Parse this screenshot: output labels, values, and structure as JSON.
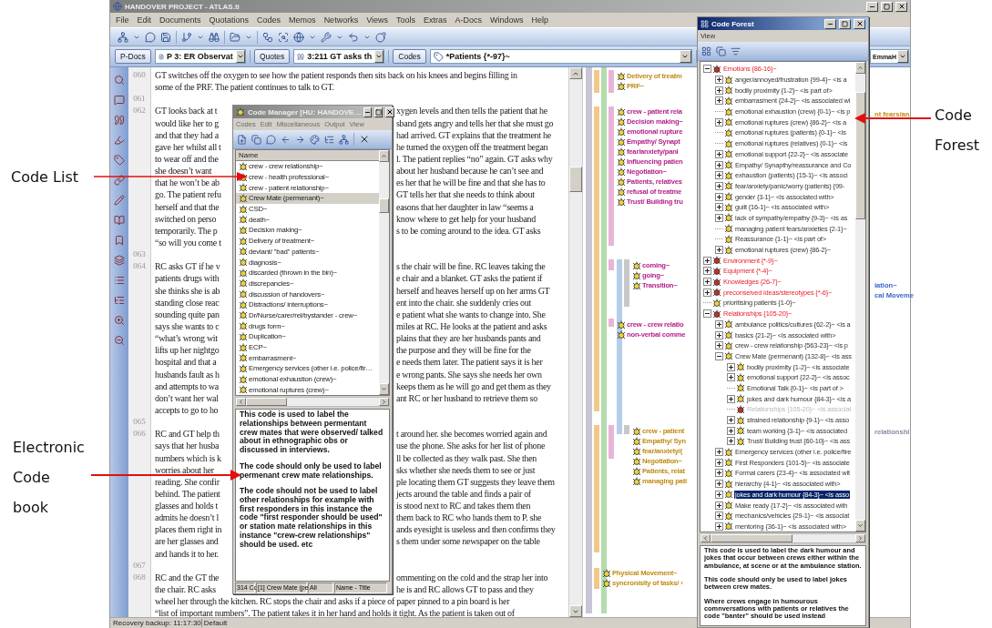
{
  "annotations": [
    {
      "text": "Code List"
    },
    {
      "text": "Electronic Code book"
    },
    {
      "text": "Code Forest"
    }
  ],
  "window": {
    "title": "HANDOVER PROJECT - ATLAS.ti",
    "active": false,
    "menu": [
      "File",
      "Edit",
      "Documents",
      "Quotations",
      "Codes",
      "Memos",
      "Networks",
      "Views",
      "Tools",
      "Extras",
      "A-Docs",
      "Windows",
      "Help"
    ],
    "status": "Recovery backup: 11:17:30",
    "status_right": "Default"
  },
  "selectors": [
    {
      "kind": "document",
      "button": "P-Docs",
      "value": "P 3: ER Observat"
    },
    {
      "kind": "quotation",
      "button": "Quotes",
      "value": "3:211 GT asks th"
    },
    {
      "kind": "code",
      "button": "Codes",
      "value": "*Patients {*-97}~"
    }
  ],
  "user_combo": "EmmaH",
  "document": [
    {
      "kind": "full",
      "number": "060",
      "text": "GT switches off the oxygen to see how the patient responds then sits back on his knees and begins filling in"
    },
    {
      "kind": "full",
      "text": "some of the PRF. The patient continues to talk to GT."
    },
    {
      "kind": "blank",
      "number": "061"
    },
    {
      "kind": "split",
      "number": "062",
      "left": "GT looks back at t",
      "right": "xygen levels and then tells the patient that he"
    },
    {
      "kind": "split",
      "left": "would like her to g",
      "right": "sband gets angry and tells her that she must go"
    },
    {
      "kind": "split",
      "left": "and that they had a",
      "right": "had arrived. GT explains that the treatment he"
    },
    {
      "kind": "split",
      "left": "gave her whilst all t",
      "right": "he turned the oxygen off the treatment began"
    },
    {
      "kind": "split",
      "left": "to wear off and the",
      "right": "l. The patient replies “no” again. GT asks why"
    },
    {
      "kind": "split",
      "left": "she doesn’t want",
      "right": "about her husband because he can’t see and"
    },
    {
      "kind": "split",
      "left": "that he won’t be ab",
      "right": "es her that he will be fine and that she has to"
    },
    {
      "kind": "split",
      "left": "go. The patient refu",
      "right": "GT tells her that she needs to think about"
    },
    {
      "kind": "split",
      "left": "herself and that the",
      "right": "easons that her daughter in law “seems a"
    },
    {
      "kind": "split",
      "left": "switched on perso",
      "right": "know where to get help for your husband"
    },
    {
      "kind": "split",
      "left": "temporarily. The p",
      "right": "s to be coming around to the idea. GT asks"
    },
    {
      "kind": "split",
      "left": "“so will you come t"
    },
    {
      "kind": "blank",
      "number": "063"
    },
    {
      "kind": "split",
      "number": "064",
      "left": "RC asks GT if he v",
      "right": "s the chair will be fine. RC leaves taking the"
    },
    {
      "kind": "split",
      "left": "patients drugs with",
      "right": "e chair and a blanket. GT asks the patient if"
    },
    {
      "kind": "split",
      "left": "she thinks she is ab",
      "right": "herself and heaves herself up on her arms GT"
    },
    {
      "kind": "split",
      "left": "standing close reac",
      "right": "ent into the chair. she suddenly cries out"
    },
    {
      "kind": "split",
      "left": "sounding quite pan",
      "right": "e patient what she wants to change into. She"
    },
    {
      "kind": "split",
      "left": "says she wants to c",
      "right": "miles at RC. He looks at the patient and asks"
    },
    {
      "kind": "split",
      "left": "“what’s wrong wit",
      "right": "plains that they are her husbands pants and"
    },
    {
      "kind": "split",
      "left": "lifts up her nightgo",
      "right": "the purpose and they will be fine for the"
    },
    {
      "kind": "split",
      "left": "hospital and that a",
      "right": "e needs them later. The patient says it is her"
    },
    {
      "kind": "split",
      "left": "husbands fault as h",
      "right": "e wrong pants. She says she needs her own"
    },
    {
      "kind": "split",
      "left": "and attempts to wa",
      "right": "keeps them as he will go and get them as they"
    },
    {
      "kind": "split",
      "left": "don’t want her wal",
      "right": "ant RC or her husband to retrieve them so"
    },
    {
      "kind": "split",
      "left": "accepts to go to ho"
    },
    {
      "kind": "blank",
      "number": "065"
    },
    {
      "kind": "split",
      "number": "066",
      "left": "RC and GT help th",
      "right": "t around her. she becomes worried again and"
    },
    {
      "kind": "split",
      "left": "says that her husba",
      "right": "use the phone. She asks for her list of phone"
    },
    {
      "kind": "split",
      "left": "numbers which is k",
      "right": "ll be collected as they walk past. She then"
    },
    {
      "kind": "split",
      "left": "worries about her",
      "right": "sks whether she needs them to see or just"
    },
    {
      "kind": "split",
      "left": "reading. She confir",
      "right": "ple locating them GT suggests they leave them"
    },
    {
      "kind": "split",
      "left": "behind. The patient",
      "right": "jects around the table and finds a pair of"
    },
    {
      "kind": "split",
      "left": "glasses and holds t",
      "right": "is stood next to RC and takes them then"
    },
    {
      "kind": "split",
      "left": "admits he doesn’t l",
      "right": "them back to RC who hands them to P. she"
    },
    {
      "kind": "split",
      "left": "places them right in",
      "right": "ands eyesight is useless and then confirms they"
    },
    {
      "kind": "split",
      "left": "are her glasses and",
      "right": "s them under some newspaper on the table"
    },
    {
      "kind": "split",
      "left": "and hands it to her."
    },
    {
      "kind": "blank",
      "number": "067"
    },
    {
      "kind": "split",
      "number": "068",
      "left": "RC and the GT the",
      "right": "ommenting on the cold and the strap her into"
    },
    {
      "kind": "split",
      "left": "the chair. RC asks",
      "right": "he is and RC allows GT to pass and they"
    },
    {
      "kind": "full",
      "text": "wheel her through the kitchen. RC stops the chair and asks if a piece of paper pinned to a pin board is her"
    },
    {
      "kind": "full",
      "text": "“list of important numbers”. The patient takes it in her hand and holds it tight. As the patient is taken out of"
    }
  ],
  "margin_groups": [
    [
      {
        "label": "Delivery of treatm",
        "color": "#c08a10"
      },
      {
        "label": "PRF~",
        "color": "#c08a10"
      }
    ],
    [
      {
        "label": "crew - patient rela",
        "color": "#b4208c"
      },
      {
        "label": "Decision making~",
        "color": "#b4208c"
      },
      {
        "label": "emotional rupture",
        "color": "#b4208c"
      },
      {
        "label": "Empathy/ Synapt",
        "color": "#b4208c"
      },
      {
        "label": "fear/anxiety/pani",
        "color": "#b4208c"
      },
      {
        "label": "Influencing patien",
        "color": "#b4208c"
      },
      {
        "label": "Negotiation~",
        "color": "#b4208c"
      },
      {
        "label": "Patients, relatives",
        "color": "#b4208c"
      },
      {
        "label": "refusal of treatme",
        "color": "#b4208c"
      },
      {
        "label": "Trust/ Building tru",
        "color": "#b4208c"
      }
    ],
    [
      {
        "label": "coming~",
        "color": "#b4208c"
      },
      {
        "label": "going~",
        "color": "#b4208c"
      },
      {
        "label": "Transition~",
        "color": "#b4208c"
      }
    ],
    [
      {
        "label": "crew - crew relatio",
        "color": "#b4208c"
      },
      {
        "label": "non-verbal comme",
        "color": "#b4208c"
      }
    ],
    [
      {
        "label": "crew - patient",
        "color": "#c08a10"
      },
      {
        "label": "Empathy/ Syn",
        "color": "#c08a10"
      },
      {
        "label": "fear/anxiety/(",
        "color": "#c08a10"
      },
      {
        "label": "Negotiation~",
        "color": "#c08a10"
      },
      {
        "label": "Patients, relat",
        "color": "#c08a10"
      },
      {
        "label": "managing pati",
        "color": "#c08a10"
      }
    ],
    [
      {
        "label": "Physical Movement~",
        "color": "#c08a10"
      },
      {
        "label": "syncronisity of tasks/ ‹",
        "color": "#c08a10"
      }
    ]
  ],
  "right_strip": [
    {
      "text": "nt fears/an",
      "color": "#c08a10"
    },
    {
      "text": "iation~",
      "color": "#3a66c8"
    },
    {
      "text": "cal Moveme",
      "color": "#3a66c8"
    },
    {
      "text": "relationshi",
      "color": "#8a8aa0"
    }
  ],
  "code_manager": {
    "title": "Code Manager [HU: HANDOVE…",
    "active": false,
    "menu": [
      "Codes",
      "Edit",
      "Miscellaneous",
      "Output",
      "View"
    ],
    "column": "Name",
    "items": [
      {
        "label": "crew - crew relationship~",
        "selected": false
      },
      {
        "label": "crew - health professional~",
        "selected": false
      },
      {
        "label": "crew - patient relationship~",
        "selected": false
      },
      {
        "label": "Crew Mate (permenant)~",
        "selected": true
      },
      {
        "label": "CSD~",
        "selected": false
      },
      {
        "label": "death~",
        "selected": false
      },
      {
        "label": "Decision making~",
        "selected": false
      },
      {
        "label": "Delivery of treatment~",
        "selected": false
      },
      {
        "label": "deviant/ \"bad\" patients~",
        "selected": false
      },
      {
        "label": "diagnosis~",
        "selected": false
      },
      {
        "label": "discarded (thrown in the bin)~",
        "selected": false
      },
      {
        "label": "discrepancies~",
        "selected": false
      },
      {
        "label": "discussion of handovers~",
        "selected": false
      },
      {
        "label": "Distractions/ interruptions~",
        "selected": false
      },
      {
        "label": "Dr/Nurse/carer/rel/bystander - crew~",
        "selected": false
      },
      {
        "label": "drugs form~",
        "selected": false
      },
      {
        "label": "Duplication~",
        "selected": false
      },
      {
        "label": "ECP~",
        "selected": false
      },
      {
        "label": "embarrasment~",
        "selected": false
      },
      {
        "label": "Emergency services (other i.e. police/fir…",
        "selected": false
      },
      {
        "label": "emotional exhaustion (crew)~",
        "selected": false
      },
      {
        "label": "emotional ruptures (crew)~",
        "selected": false
      }
    ],
    "memo": [
      "This code is used to label the relationships between permentant crew mates that were observed/ talked about in ethnographic obs or discussed in interviews.",
      "The code should only be used to label permenant crew mate relationships.",
      "The code should not be used to label other relationships for example with first responders in this instance the code \"first responder should be used\" or station mate relationships in this instance \"crew-crew relationships\" should be used. etc"
    ],
    "status": [
      "314 Cc",
      "[1] Crew Mate (pe",
      "All",
      "Name - Title"
    ]
  },
  "code_forest": {
    "title": "Code Forest",
    "active": true,
    "menu": [
      "View"
    ],
    "tree": [
      {
        "label": "Emotions {86-16}~",
        "kind": "family",
        "expanded": true,
        "selected": false,
        "children": [
          {
            "label": "anger/annoyed/frustration {99-4}~ <is a",
            "kind": "code",
            "expanded": false,
            "selected": false
          },
          {
            "label": "bodily proximity {1-2}~ <is part of>",
            "kind": "code",
            "expanded": false,
            "selected": false
          },
          {
            "label": "embarrasment {24-2}~ <is associated wi",
            "kind": "code",
            "expanded": false,
            "selected": false
          },
          {
            "label": "emotional exhaustion (crew) {0-1}~ <is p",
            "kind": "code",
            "selected": false
          },
          {
            "label": "emotional ruptures (crew) {86-2}~ <is a",
            "kind": "code",
            "expanded": false,
            "selected": false
          },
          {
            "label": "emotional ruptures (patients) {0-1}~ <is",
            "kind": "code",
            "selected": false
          },
          {
            "label": "emotional ruptures (relatives) {0-1}~ <is",
            "kind": "code",
            "selected": false
          },
          {
            "label": "emotional support {22-2}~ <is associate",
            "kind": "code",
            "expanded": false,
            "selected": false
          },
          {
            "label": "Empathy/ Synapthy/reassurance and Co",
            "kind": "code",
            "expanded": false,
            "selected": false
          },
          {
            "label": "exhaustion (patients) {15-1}~ <is associ",
            "kind": "code",
            "expanded": false,
            "selected": false
          },
          {
            "label": "fear/anxiety/panic/worry (patients) {99-",
            "kind": "code",
            "expanded": false,
            "selected": false
          },
          {
            "label": "gender {3-1}~ <is associated with>",
            "kind": "code",
            "expanded": false,
            "selected": false
          },
          {
            "label": "guilt {16-1}~ <is associated with>",
            "kind": "code",
            "expanded": false,
            "selected": false
          },
          {
            "label": "lack of sympathy/empathy {9-3}~ <is as",
            "kind": "code",
            "expanded": false,
            "selected": false
          },
          {
            "label": "managing patient fears/anxieties {2-1}~",
            "kind": "code",
            "selected": false
          },
          {
            "label": "Reassurance {1-1}~ <is part of>",
            "kind": "code",
            "selected": false
          },
          {
            "label": "emotional ruptures (crew) {86-2}~",
            "kind": "code",
            "expanded": false,
            "selected": false
          }
        ]
      },
      {
        "label": "Environment {*-9}~",
        "kind": "family",
        "expanded": false,
        "selected": false
      },
      {
        "label": "Equipment {*-4}~",
        "kind": "family",
        "expanded": false,
        "selected": false
      },
      {
        "label": "Knowledges {26-7}~",
        "kind": "family",
        "expanded": false,
        "selected": false
      },
      {
        "label": "preconseived ideas/stereotypes {*-6}~",
        "kind": "family",
        "expanded": false,
        "selected": false
      },
      {
        "label": "prioritising patients {1-0}~",
        "kind": "code",
        "selected": false
      },
      {
        "label": "Relationships {105-20}~",
        "kind": "family",
        "expanded": true,
        "selected": false,
        "children": [
          {
            "label": "ambulance politics/cultures {62-2}~ <is a",
            "kind": "code",
            "expanded": false,
            "selected": false
          },
          {
            "label": "basics {21-2}~ <is associated with>",
            "kind": "code",
            "expanded": false,
            "selected": false
          },
          {
            "label": "crew - crew relationship {563-23}~ <is p",
            "kind": "code",
            "expanded": false,
            "selected": false
          },
          {
            "label": "Crew Mate (permenant) {132-8}~ <is ass",
            "kind": "code",
            "expanded": true,
            "selected": false,
            "children": [
              {
                "label": "bodily proximity {1-2}~ <is associate",
                "kind": "code",
                "expanded": false,
                "selected": false,
                "disabled": false
              },
              {
                "label": "emotional support {22-2}~ <is assoc",
                "kind": "code",
                "expanded": false,
                "selected": false,
                "disabled": false
              },
              {
                "label": "Emotional Talk {0-1}~ <is part of >",
                "kind": "code",
                "selected": false,
                "disabled": false
              },
              {
                "label": "jokes and dark humour {84-3}~ <is a",
                "kind": "code",
                "expanded": false,
                "selected": false,
                "disabled": false
              },
              {
                "label": "Relationships {105-20}~ <is associat",
                "kind": "family",
                "selected": false,
                "disabled": true
              },
              {
                "label": "strained relationship {9-1}~ <is asso",
                "kind": "code",
                "expanded": false,
                "selected": false,
                "disabled": false
              },
              {
                "label": "team working {3-1}~ <is associated",
                "kind": "code",
                "expanded": false,
                "selected": false,
                "disabled": false
              },
              {
                "label": "Trust/ Building trust {60-10}~ <is ass",
                "kind": "code",
                "expanded": false,
                "selected": false,
                "disabled": false
              }
            ]
          },
          {
            "label": "Emergency services (other i.e. police/fire",
            "kind": "code",
            "expanded": false,
            "selected": false
          },
          {
            "label": "First Responders {101-5}~ <is associate",
            "kind": "code",
            "expanded": false,
            "selected": false
          },
          {
            "label": "Formal carers {23-4}~ <is associated wit",
            "kind": "code",
            "expanded": false,
            "selected": false
          },
          {
            "label": "hierarchy {4-1}~ <is associated with>",
            "kind": "code",
            "expanded": false,
            "selected": false
          },
          {
            "label": "jokes and dark humour {84-3}~ <is asso",
            "kind": "code",
            "expanded": false,
            "selected": true
          },
          {
            "label": "Make ready {17-2}~ <is associated with",
            "kind": "code",
            "expanded": false,
            "selected": false
          },
          {
            "label": "mechanics/vehicles {29-1}~ <is associat",
            "kind": "code",
            "expanded": false,
            "selected": false
          },
          {
            "label": "mentoring {36-1}~ <is associated with>",
            "kind": "code",
            "expanded": false,
            "selected": false
          }
        ]
      }
    ],
    "memo": [
      "This code is used to label the dark humour and jokes that occur between crews either within the ambulance, at scene or at the ambulance station.",
      "This code should only be used to label jokes between crew mates.",
      "Where crews engage in humourous comnversations with patients or relatives the code \"banter\" should be used instead"
    ]
  }
}
